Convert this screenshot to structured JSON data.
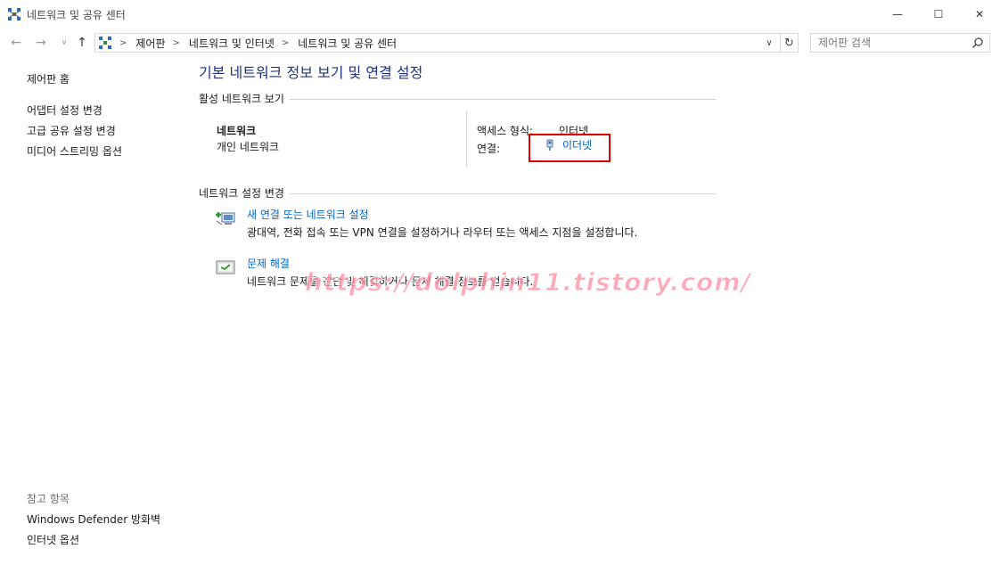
{
  "window": {
    "title": "네트워크 및 공유 센터",
    "minimize_glyph": "—",
    "maximize_glyph": "☐",
    "close_glyph": "✕"
  },
  "nav": {
    "back_glyph": "←",
    "forward_glyph": "→",
    "recent_glyph": "∨",
    "up_glyph": "↑",
    "breadcrumbs": [
      "제어판",
      "네트워크 및 인터넷",
      "네트워크 및 공유 센터"
    ],
    "separator": ">",
    "dropdown_glyph": "∨",
    "refresh_glyph": "↻"
  },
  "search": {
    "placeholder": "제어판 검색",
    "icon": "search-icon"
  },
  "left_nav": {
    "home": "제어판 홈",
    "tasks": [
      "어댑터 설정 변경",
      "고급 공유 설정 변경",
      "미디어 스트리밍 옵션"
    ]
  },
  "see_also": {
    "header": "참고 항목",
    "links": [
      "Windows Defender 방화벽",
      "인터넷 옵션"
    ]
  },
  "main": {
    "title": "기본 네트워크 정보 보기 및 연결 설정",
    "active_section": {
      "header": "활성 네트워크 보기",
      "network_name": "네트워크",
      "network_type": "개인 네트워크",
      "access_label": "액세스 형식:",
      "access_value": "인터넷",
      "connection_label": "연결:",
      "connection_value": "이더넷"
    },
    "change_section": {
      "header": "네트워크 설정 변경",
      "items": [
        {
          "icon": "new-connection-icon",
          "link": "새 연결 또는 네트워크 설정",
          "desc": "광대역, 전화 접속 또는 VPN 연결을 설정하거나 라우터 또는 액세스 지점을 설정합니다."
        },
        {
          "icon": "troubleshoot-icon",
          "link": "문제 해결",
          "desc": "네트워크 문제를 진단 및 해결하거나 문제 해결 정보를 얻습니다."
        }
      ]
    }
  },
  "watermark": "https://dolphin11.tistory.com/",
  "colors": {
    "title_blue": "#1e3287",
    "link_blue": "#0066cc",
    "highlight_red": "#e00000"
  }
}
